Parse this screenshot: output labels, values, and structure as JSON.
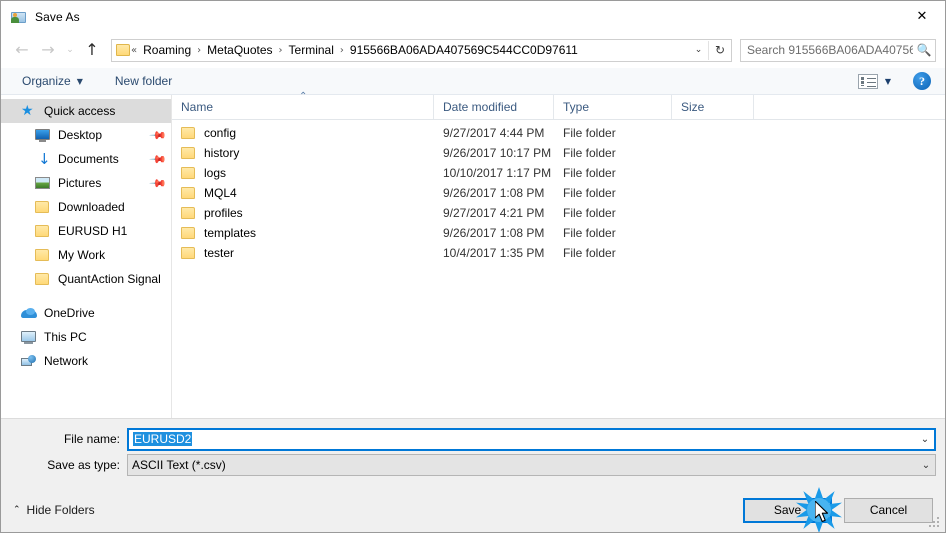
{
  "window": {
    "title": "Save As",
    "title_icon": "save-as-folder-user-icon",
    "close_label": "✕"
  },
  "navigation": {
    "back_icon": "←",
    "forward_icon": "→",
    "recent_icon": "⌄",
    "up_icon": "↑",
    "breadcrumb_root_icon": "folder-icon",
    "breadcrumb_overflow": "«",
    "breadcrumb_separator": "›",
    "breadcrumbs": [
      "Roaming",
      "MetaQuotes",
      "Terminal",
      "915566BA06ADA407569C544CC0D97611"
    ],
    "address_dropdown_icon": "⌄",
    "refresh_icon": "↻"
  },
  "search": {
    "placeholder": "Search 915566BA06ADA40756...",
    "icon": "search-icon"
  },
  "toolbar": {
    "organize_label": "Organize",
    "organize_caret": "▼",
    "new_folder_label": "New folder",
    "view_icon": "view-layout-icon",
    "view_caret": "▼",
    "help_icon": "?",
    "help_label": "?"
  },
  "sidebar": {
    "items": [
      {
        "label": "Quick access",
        "icon": "star-icon",
        "selected": true,
        "indent": false,
        "pinned": false
      },
      {
        "label": "Desktop",
        "icon": "monitor-icon",
        "selected": false,
        "indent": true,
        "pinned": true
      },
      {
        "label": "Documents",
        "icon": "download-arrow-icon",
        "selected": false,
        "indent": true,
        "pinned": true
      },
      {
        "label": "Pictures",
        "icon": "picture-icon",
        "selected": false,
        "indent": true,
        "pinned": true
      },
      {
        "label": "Downloaded",
        "icon": "folder-icon",
        "selected": false,
        "indent": true,
        "pinned": false
      },
      {
        "label": "EURUSD H1",
        "icon": "folder-icon",
        "selected": false,
        "indent": true,
        "pinned": false
      },
      {
        "label": "My Work",
        "icon": "folder-icon",
        "selected": false,
        "indent": true,
        "pinned": false
      },
      {
        "label": "QuantAction Signal",
        "icon": "folder-icon",
        "selected": false,
        "indent": true,
        "pinned": false
      },
      {
        "label": "OneDrive",
        "icon": "cloud-icon",
        "selected": false,
        "indent": false,
        "pinned": false
      },
      {
        "label": "This PC",
        "icon": "computer-icon",
        "selected": false,
        "indent": false,
        "pinned": false
      },
      {
        "label": "Network",
        "icon": "network-icon",
        "selected": false,
        "indent": false,
        "pinned": false
      }
    ],
    "pin_icon": "📌"
  },
  "filelist": {
    "columns": [
      "Name",
      "Date modified",
      "Type",
      "Size"
    ],
    "sort_column": "Name",
    "sort_arrow": "⌃",
    "rows": [
      {
        "name": "config",
        "date": "9/27/2017 4:44 PM",
        "type": "File folder",
        "size": ""
      },
      {
        "name": "history",
        "date": "9/26/2017 10:17 PM",
        "type": "File folder",
        "size": ""
      },
      {
        "name": "logs",
        "date": "10/10/2017 1:17 PM",
        "type": "File folder",
        "size": ""
      },
      {
        "name": "MQL4",
        "date": "9/26/2017 1:08 PM",
        "type": "File folder",
        "size": ""
      },
      {
        "name": "profiles",
        "date": "9/27/2017 4:21 PM",
        "type": "File folder",
        "size": ""
      },
      {
        "name": "templates",
        "date": "9/26/2017 1:08 PM",
        "type": "File folder",
        "size": ""
      },
      {
        "name": "tester",
        "date": "10/4/2017 1:35 PM",
        "type": "File folder",
        "size": ""
      }
    ]
  },
  "form": {
    "filename_label": "File name:",
    "filename_value": "EURUSD2",
    "filename_selected": true,
    "filetype_label": "Save as type:",
    "filetype_value": "ASCII Text (*.csv)",
    "dropdown_caret": "⌄"
  },
  "footer": {
    "hide_folders_label": "Hide Folders",
    "hide_folders_caret": "⌃",
    "save_label": "Save",
    "cancel_label": "Cancel"
  },
  "colors": {
    "accent": "#0078d7",
    "selection": "#1e90df",
    "burst": "#1a9ae8",
    "folder": "#ffd978",
    "chrome": "#f0f0f0"
  }
}
